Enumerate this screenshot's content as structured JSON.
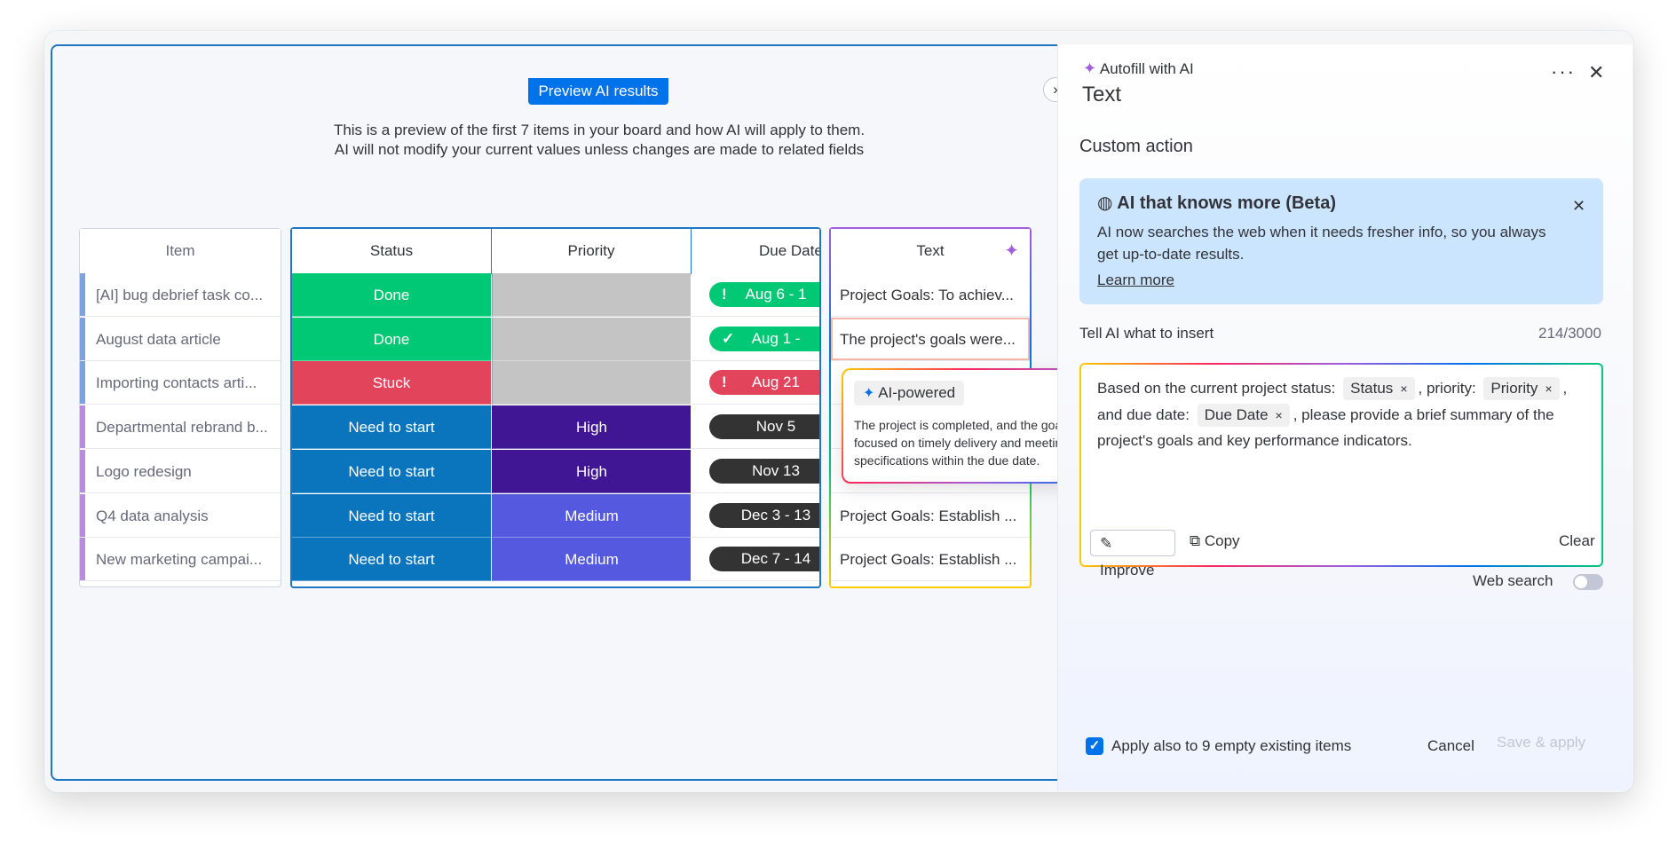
{
  "preview": {
    "badge": "Preview AI results",
    "intro_line1": "This is a preview of the first 7 items in your board and how AI will apply to them.",
    "intro_line2": "AI will not modify your current values unless changes are made to related fields"
  },
  "table": {
    "headers": {
      "item": "Item",
      "status": "Status",
      "priority": "Priority",
      "due_date": "Due Date",
      "text": "Text"
    },
    "rows": [
      {
        "item": "[AI] bug debrief task co...",
        "status": "Done",
        "priority": "",
        "due": "Aug 6 - 1",
        "due_mark": "!",
        "text": "Project Goals: To achiev..."
      },
      {
        "item": "August data article",
        "status": "Done",
        "priority": "",
        "due": "Aug 1 -",
        "due_mark": "✓",
        "text": "The project's goals were..."
      },
      {
        "item": "Importing contacts arti...",
        "status": "Stuck",
        "priority": "",
        "due": "Aug 21",
        "due_mark": "!",
        "text": ""
      },
      {
        "item": "Departmental rebrand b...",
        "status": "Need to start",
        "priority": "High",
        "due": "Nov 5",
        "due_mark": "",
        "text": ""
      },
      {
        "item": "Logo redesign",
        "status": "Need to start",
        "priority": "High",
        "due": "Nov 13",
        "due_mark": "",
        "text": ""
      },
      {
        "item": "Q4 data analysis",
        "status": "Need to start",
        "priority": "Medium",
        "due": "Dec 3 - 13",
        "due_mark": "",
        "text": "Project Goals: Establish ..."
      },
      {
        "item": "New marketing campai...",
        "status": "Need to start",
        "priority": "Medium",
        "due": "Dec 7 - 14",
        "due_mark": "",
        "text": "Project Goals: Establish ..."
      }
    ]
  },
  "tooltip": {
    "badge": "AI-powered",
    "text": "The project is completed, and the goals focused on timely delivery and meeting specifications within the due date."
  },
  "panel": {
    "header": "Autofill with AI",
    "column_title": "Text",
    "section_title": "Custom action",
    "beta": {
      "title": "AI that knows more (Beta)",
      "line1": "AI now searches the web when it needs fresher info, so you always",
      "line2": "get up-to-date results.",
      "link": "Learn more"
    },
    "prompt_label": "Tell AI what to insert",
    "char_count": "214/3000",
    "prompt": {
      "p1": "Based on the current project status:",
      "chip_status": "Status",
      "p2": ", priority:",
      "chip_priority": "Priority",
      "p3": ",",
      "p4": "and due date:",
      "chip_due": "Due Date",
      "p5": ", please provide a brief summary of the",
      "p6": "project's goals and key performance indicators.",
      "chip_remove": "×"
    },
    "improve": "Improve",
    "copy": "Copy",
    "clear": "Clear",
    "web_search": "Web search",
    "apply_empty": "Apply also to 9 empty existing items",
    "cancel": "Cancel",
    "save": "Save & apply"
  },
  "colors": {
    "done": "#00c875",
    "stuck": "#e2445c",
    "need_to_start": "#0a75bd",
    "high": "#401694",
    "medium": "#5559df",
    "empty_priority": "#c4c4c4",
    "accent": "#0073ea"
  }
}
